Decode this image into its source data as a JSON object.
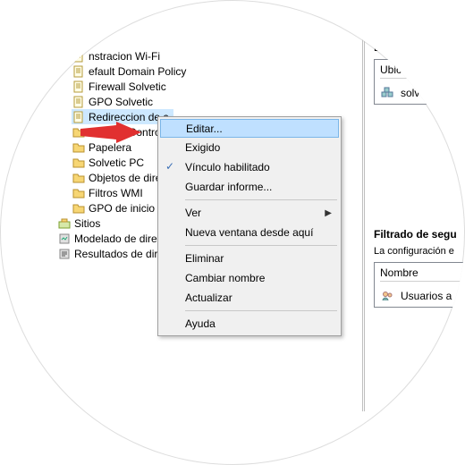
{
  "tree": {
    "items": [
      {
        "label": "nstracion Wi-Fi",
        "icon": "scroll",
        "indent": 1
      },
      {
        "label": "efault Domain Policy",
        "icon": "scroll",
        "indent": 1
      },
      {
        "label": "Firewall Solvetic",
        "icon": "scroll",
        "indent": 1
      },
      {
        "label": "GPO Solvetic",
        "icon": "scroll",
        "indent": 1
      },
      {
        "label": "Redireccion de c",
        "icon": "scroll",
        "indent": 1,
        "selected": true
      },
      {
        "label": "Domain Controll",
        "icon": "folder",
        "indent": 1
      },
      {
        "label": "Papelera",
        "icon": "folder",
        "indent": 1
      },
      {
        "label": "Solvetic PC",
        "icon": "folder",
        "indent": 1
      },
      {
        "label": "Objetos de direc",
        "icon": "folder",
        "indent": 1
      },
      {
        "label": "Filtros WMI",
        "icon": "folder",
        "indent": 1
      },
      {
        "label": "GPO de inicio",
        "icon": "folder",
        "indent": 1
      },
      {
        "label": "Sitios",
        "icon": "sites",
        "indent": 0
      },
      {
        "label": "Modelado de directivas",
        "icon": "model",
        "indent": 0
      },
      {
        "label": "Resultados de directivas",
        "icon": "results",
        "indent": 0
      }
    ]
  },
  "menu": {
    "items": [
      {
        "label": "Editar...",
        "highlight": true
      },
      {
        "label": "Exigido"
      },
      {
        "label": "Vínculo habilitado",
        "checked": true
      },
      {
        "label": "Guardar informe..."
      },
      {
        "sep": true
      },
      {
        "label": "Ver",
        "submenu": true
      },
      {
        "label": "Nueva ventana desde aquí"
      },
      {
        "sep": true
      },
      {
        "label": "Eliminar"
      },
      {
        "label": "Cambiar nombre"
      },
      {
        "label": "Actualizar"
      },
      {
        "sep": true
      },
      {
        "label": "Ayuda"
      }
    ]
  },
  "right": {
    "vinc_text": "Los sig",
    "box1_head": "Ubicacio",
    "box1_row": "solvetic.",
    "filtrado_hdr": "Filtrado de segu",
    "filtrado_sub": "La configuración e",
    "box2_head": "Nombre",
    "box2_row": "Usuarios a"
  }
}
